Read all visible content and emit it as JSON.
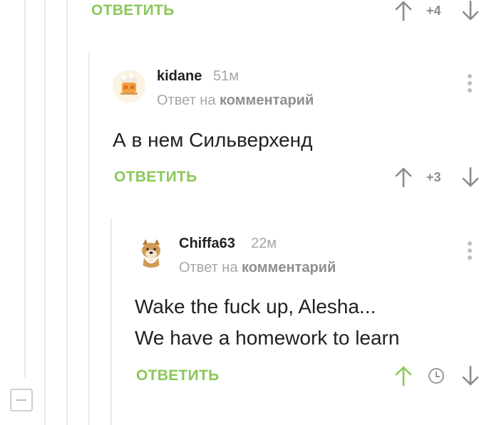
{
  "comments": [
    {
      "reply_label": "ОТВЕТИТЬ",
      "rating": "+4"
    },
    {
      "nick": "kidane",
      "time": "51м",
      "reply_to_prefix": "Ответ на",
      "reply_to_link": "комментарий",
      "text": "А в нем Сильверхенд",
      "reply_label": "ОТВЕТИТЬ",
      "rating": "+3"
    },
    {
      "nick": "Chiffa63",
      "time": "22м",
      "reply_to_prefix": "Ответ на",
      "reply_to_link": "комментарий",
      "text_line1": "Wake the fuck up, Alesha...",
      "text_line2": "We have a homework to learn",
      "reply_label": "ОТВЕТИТЬ"
    }
  ],
  "colors": {
    "accent": "#8ac858",
    "muted": "#a6a6a6",
    "upvoted": "#8ac858"
  },
  "icons": [
    "arrow-up-icon",
    "arrow-down-icon",
    "menu-dots-icon",
    "clock-icon",
    "collapse-icon"
  ]
}
